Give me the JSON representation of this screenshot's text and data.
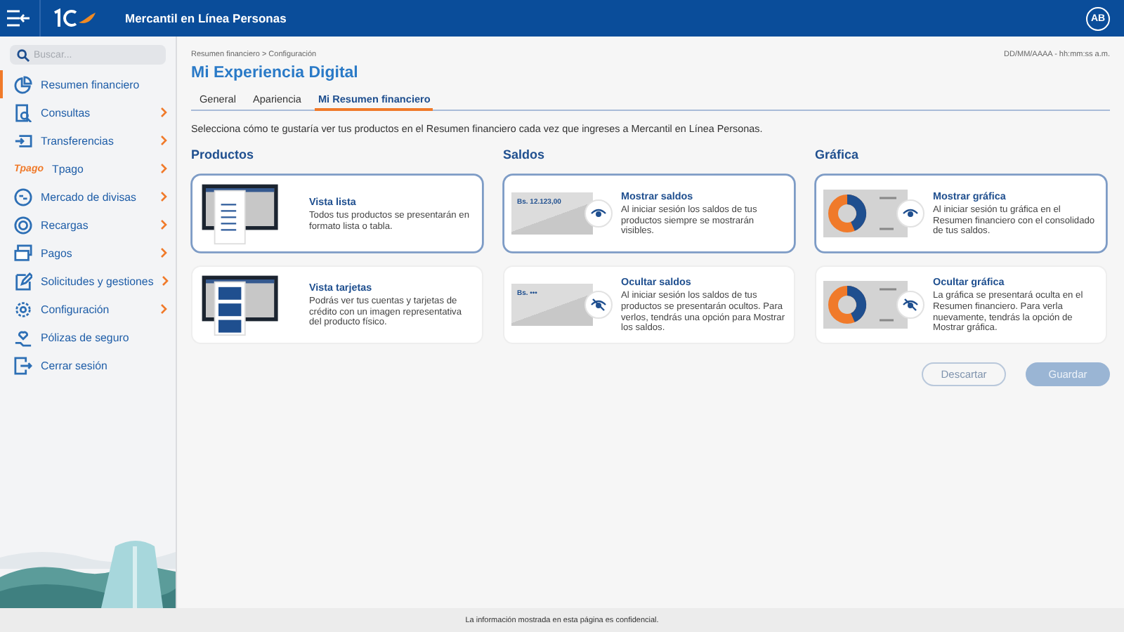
{
  "header": {
    "title": "Mercantil en Línea Personas",
    "avatar": "AB"
  },
  "sidebar": {
    "search": {
      "placeholder": "Buscar..."
    },
    "items": [
      {
        "label": "Resumen financiero",
        "selected": true,
        "has_submenu": false
      },
      {
        "label": "Consultas",
        "selected": false,
        "has_submenu": true
      },
      {
        "label": "Transferencias",
        "selected": false,
        "has_submenu": true
      },
      {
        "label": "Tpago",
        "logo_text": "Tpago",
        "selected": false,
        "has_submenu": true
      },
      {
        "label": "Mercado de divisas",
        "selected": false,
        "has_submenu": true
      },
      {
        "label": "Recargas",
        "selected": false,
        "has_submenu": true
      },
      {
        "label": "Pagos",
        "selected": false,
        "has_submenu": true
      },
      {
        "label": "Solicitudes y gestiones",
        "selected": false,
        "has_submenu": true
      },
      {
        "label": "Configuración",
        "selected": false,
        "has_submenu": true
      },
      {
        "label": "Pólizas de seguro",
        "selected": false,
        "has_submenu": false
      },
      {
        "label": "Cerrar sesión",
        "selected": false,
        "has_submenu": false
      }
    ]
  },
  "page": {
    "breadcrumb": "Resumen financiero > Configuración",
    "datetime": "DD/MM/AAAA - hh:mm:ss a.m.",
    "title": "Mi Experiencia Digital",
    "tabs": [
      {
        "label": "General",
        "selected": false
      },
      {
        "label": "Apariencia",
        "selected": false
      },
      {
        "label": "Mi Resumen financiero",
        "selected": true
      }
    ],
    "description": "Selecciona cómo te gustaría ver tus productos en el Resumen financiero cada vez que ingreses a Mercantil en Línea Personas.",
    "sections": [
      {
        "title": "Productos",
        "options": [
          {
            "kind": "list",
            "title": "Vista lista",
            "text": "Todos tus productos se presentarán en formato lista o tabla.",
            "selected": true
          },
          {
            "kind": "cards",
            "title": "Vista tarjetas",
            "text": "Podrás ver tus cuentas y tarjetas de crédito con un imagen representativa del producto físico.",
            "selected": false
          }
        ]
      },
      {
        "title": "Saldos",
        "options": [
          {
            "kind": "balance-shown",
            "preview_text": "Bs. 12.123,00",
            "title": "Mostrar saldos",
            "text": "Al iniciar sesión los saldos de tus productos siempre se mostrarán visibles.",
            "selected": true
          },
          {
            "kind": "balance-hidden",
            "preview_text": "Bs. •••",
            "title": "Ocultar saldos",
            "text": "Al iniciar sesión los saldos de tus productos se presentarán ocultos. Para verlos, tendrás una opción para Mostrar los saldos.",
            "selected": false
          }
        ]
      },
      {
        "title": "Gráfica",
        "options": [
          {
            "kind": "chart-shown",
            "title": "Mostrar gráfica",
            "text": "Al iniciar sesión tu gráfica en el Resumen financiero con el consolidado de tus saldos.",
            "selected": true
          },
          {
            "kind": "chart-hidden",
            "title": "Ocultar gráfica",
            "text": "La gráfica se presentará oculta en el Resumen financiero. Para verla nuevamente, tendrás la opción de Mostrar gráfica.",
            "selected": false
          }
        ]
      }
    ],
    "buttons": [
      {
        "kind": "secondary",
        "label": "Descartar",
        "disabled": true
      },
      {
        "kind": "primary",
        "label": "Guardar",
        "disabled": true
      }
    ]
  },
  "footer": "La información mostrada en esta página es confidencial."
}
